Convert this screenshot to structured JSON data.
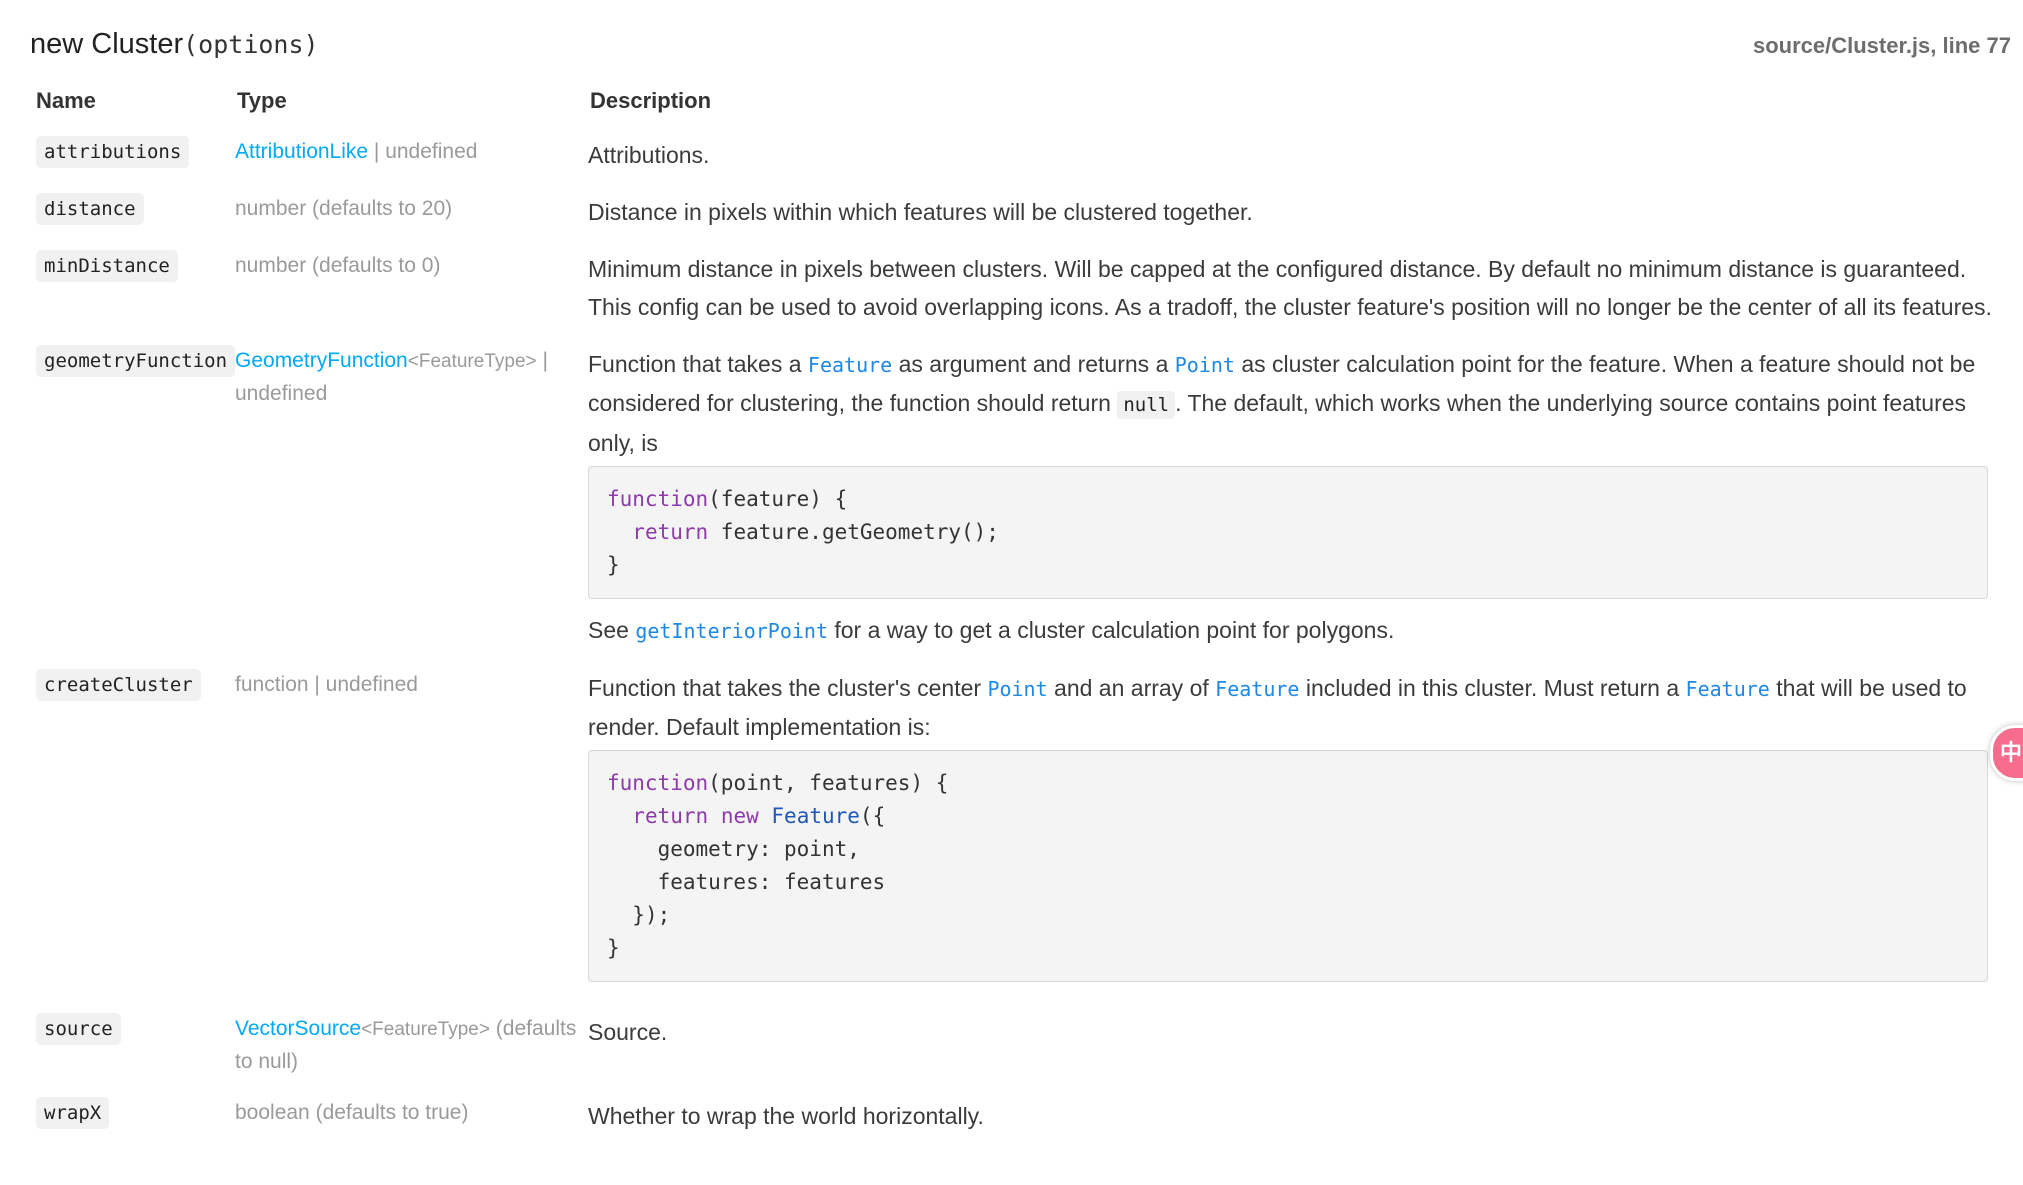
{
  "header": {
    "title": "new Cluster",
    "signature": "(options)",
    "source_ref": "source/Cluster.js, line 77"
  },
  "columns": {
    "name": "Name",
    "type": "Type",
    "description": "Description"
  },
  "params": {
    "attributions": {
      "name": "attributions",
      "type_link": "AttributionLike",
      "type_rest": " | undefined",
      "description": "Attributions."
    },
    "distance": {
      "name": "distance",
      "type_text": "number (defaults to 20)",
      "description": "Distance in pixels within which features will be clustered together."
    },
    "minDistance": {
      "name": "minDistance",
      "type_text": "number (defaults to 0)",
      "description": "Minimum distance in pixels between clusters. Will be capped at the configured distance. By default no minimum distance is guaranteed. This config can be used to avoid overlapping icons. As a tradoff, the cluster feature's position will no longer be the center of all its features."
    },
    "geometryFunction": {
      "name": "geometryFunction",
      "type_link": "GeometryFunction",
      "type_generic": "<FeatureType>",
      "type_rest": " | undefined",
      "desc_1": "Function that takes a ",
      "link_feature": "Feature",
      "desc_2": " as argument and returns a ",
      "link_point": "Point",
      "desc_3": " as cluster calculation point for the feature. When a feature should not be considered for clustering, the function should return ",
      "code_null": "null",
      "desc_4": ". The default, which works when the underlying source contains point features only, is",
      "code": {
        "l1_kw": "function",
        "l1_rest": "(feature) {",
        "l2_kw": "return",
        "l2_rest": " feature.getGeometry();",
        "l3": "}"
      },
      "see_1": "See ",
      "see_link": "getInteriorPoint",
      "see_2": " for a way to get a cluster calculation point for polygons."
    },
    "createCluster": {
      "name": "createCluster",
      "type_text": "function | undefined",
      "desc_1": "Function that takes the cluster's center ",
      "link_point": "Point",
      "desc_2": " and an array of ",
      "link_feature_1": "Feature",
      "desc_3": " included in this cluster. Must return a ",
      "link_feature_2": "Feature",
      "desc_4": " that will be used to render. Default implementation is:",
      "code": {
        "l1_kw": "function",
        "l1_rest": "(point, features) {",
        "l2_kw_return": "return",
        "l2_kw_new": "new",
        "l2_cls": "Feature",
        "l2_rest": "({",
        "l3": "geometry: point,",
        "l4": "features: features",
        "l5": "});",
        "l6": "}"
      }
    },
    "source": {
      "name": "source",
      "type_link": "VectorSource",
      "type_generic": "<FeatureType>",
      "type_rest": " (defaults to null)",
      "description": "Source."
    },
    "wrapX": {
      "name": "wrapX",
      "type_text": "boolean (defaults to true)",
      "description": "Whether to wrap the world horizontally."
    }
  },
  "translate_bubble": {
    "label": "中A",
    "icon": "translate-icon",
    "color": "#f56c8d"
  }
}
